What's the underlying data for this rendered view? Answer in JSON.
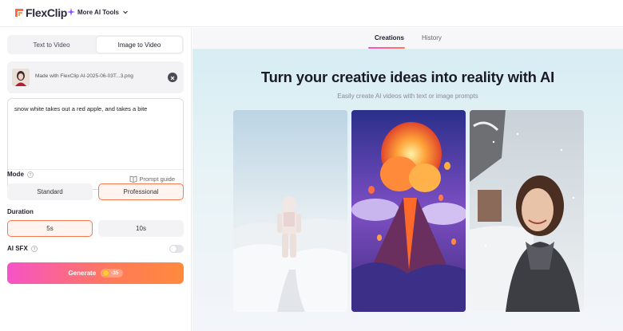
{
  "app": {
    "logo": "FlexClip",
    "more_tools": "More AI Tools"
  },
  "left": {
    "tabs": [
      {
        "label": "Text to Video",
        "active": false
      },
      {
        "label": "Image to Video",
        "active": true
      }
    ],
    "upload": {
      "filename": "Made with FlexClip AI-2025-06-03T...3.png"
    },
    "prompt": {
      "value": "snow white takes out a red apple, and takes a bite",
      "guide_label": "Prompt guide"
    },
    "mode": {
      "label": "Mode",
      "options": [
        {
          "label": "Standard",
          "selected": false
        },
        {
          "label": "Professional",
          "selected": true
        }
      ]
    },
    "duration": {
      "label": "Duration",
      "options": [
        {
          "label": "5s",
          "selected": true
        },
        {
          "label": "10s",
          "selected": false
        }
      ]
    },
    "ai_sfx": {
      "label": "AI SFX",
      "enabled": false
    },
    "generate": {
      "label": "Generate",
      "cost": "-35"
    }
  },
  "right": {
    "tabs": [
      {
        "label": "Creations",
        "active": true
      },
      {
        "label": "History",
        "active": false
      }
    ],
    "hero": {
      "title": "Turn your creative ideas into reality with AI",
      "subtitle": "Easily create AI videos with text or image prompts"
    },
    "cards": [
      {
        "name": "astronaut-in-snow"
      },
      {
        "name": "erupting-volcano"
      },
      {
        "name": "woman-in-snow-selfie"
      }
    ]
  },
  "colors": {
    "accent_start": "#f653c7",
    "accent_end": "#ff8a3d",
    "selected_border": "#f47a4e"
  }
}
